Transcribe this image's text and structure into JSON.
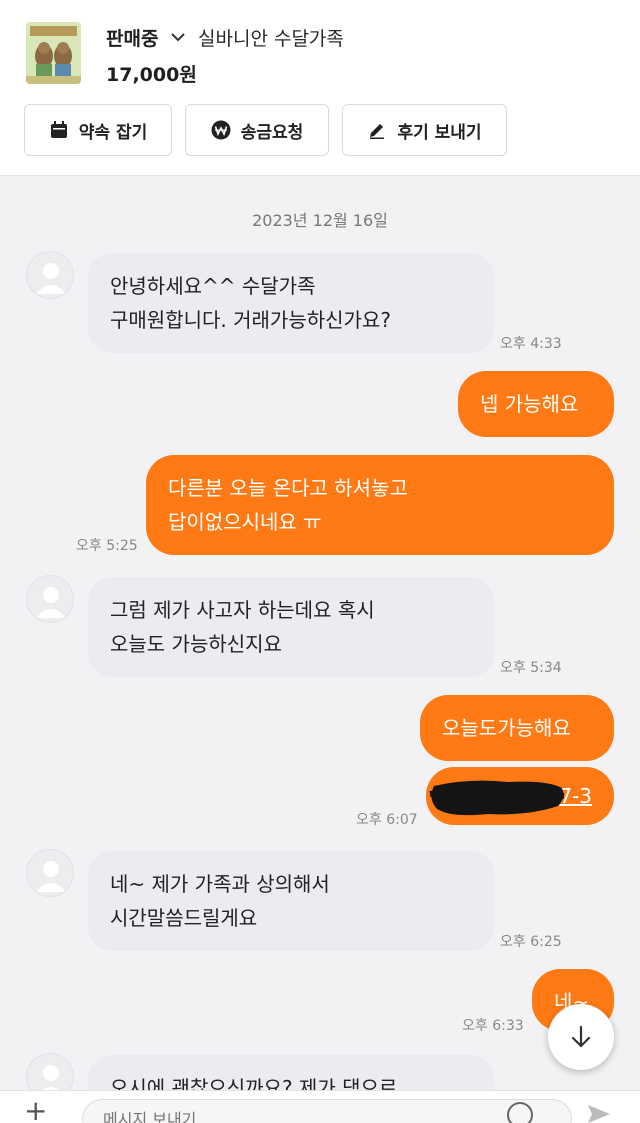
{
  "product": {
    "status": "판매중",
    "title": "실바니안 수달가족",
    "price": "17,000원",
    "thumbnail_icon": "product-photo-icon"
  },
  "actions": [
    {
      "label": "약속 잡기",
      "icon": "calendar-icon"
    },
    {
      "label": "송금요청",
      "icon": "won-icon"
    },
    {
      "label": "후기 보내기",
      "icon": "pencil-icon"
    }
  ],
  "chat": {
    "date": "2023년 12월 16일",
    "messages": [
      {
        "side": "in",
        "lines": [
          "안녕하세요^^  수달가족",
          "구매원합니다. 거래가능하신가요?"
        ],
        "time": "오후 4:33"
      },
      {
        "side": "out",
        "text": "넵 가능해요"
      },
      {
        "side": "out",
        "lines": [
          "다른분 오늘 온다고 하셔놓고",
          "답이없으시네요 ㅠ"
        ],
        "time": "오후 5:25"
      },
      {
        "side": "in",
        "lines": [
          "그럼 제가 사고자 하는데요   혹시",
          "오늘도 가능하신지요"
        ],
        "time": "오후 5:34"
      },
      {
        "side": "out",
        "text": "오늘도가능해요"
      },
      {
        "side": "out",
        "text": "7-3",
        "time": "오후 6:07"
      },
      {
        "side": "in",
        "lines": [
          "네~ 제가 가족과 상의해서",
          "시간말씀드릴게요"
        ],
        "time": "오후 6:25"
      },
      {
        "side": "out",
        "text": "네~",
        "time": "오후 6:33"
      },
      {
        "side": "in",
        "lines": [
          "오시에 괜찮으신까요? 제가 댁으로"
        ]
      }
    ]
  },
  "input": {
    "placeholder": "메시지 보내기"
  },
  "colors": {
    "accent": "#ff7a14",
    "incoming_bubble": "#ececf0",
    "background": "#f2f2f4"
  }
}
